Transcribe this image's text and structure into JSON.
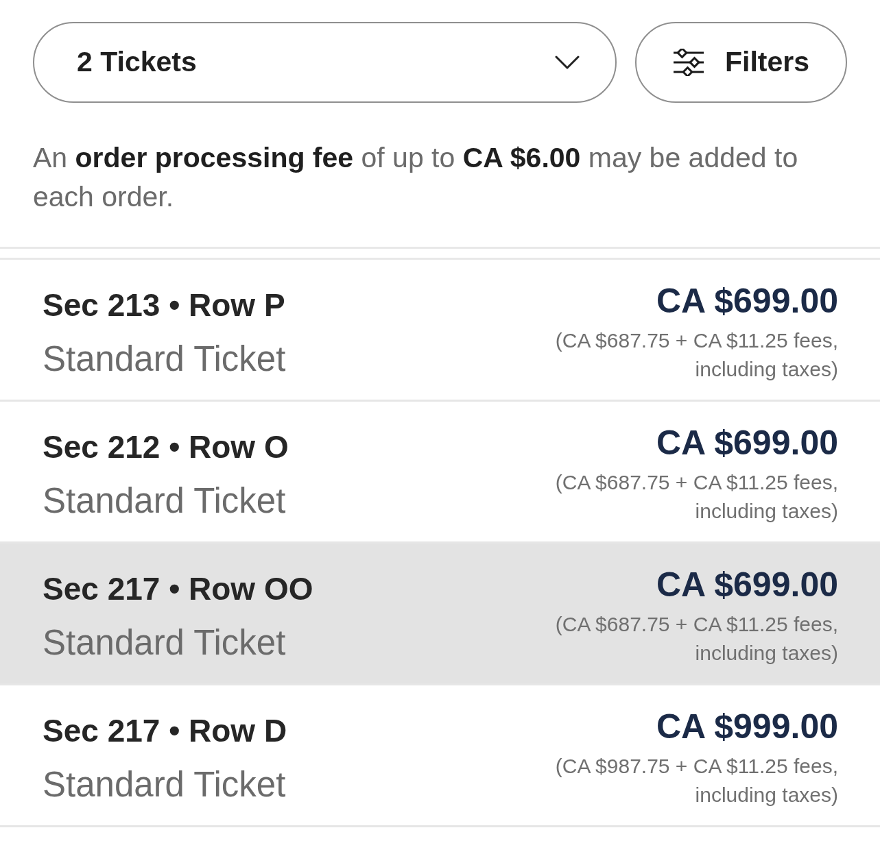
{
  "ticket_quantity": {
    "value": "2 Tickets"
  },
  "filters_button": {
    "label": "Filters"
  },
  "fee_notice": "An **order processing fee** of up to **CA $6.00** may be added to each order.",
  "listings": [
    {
      "section": "Sec 213 • Row P",
      "ticket_type": "Standard Ticket",
      "price": "CA $699.00",
      "price_breakdown": "(CA $687.75 + CA $11.25 fees, including taxes)",
      "selected": false
    },
    {
      "section": "Sec 212 • Row O",
      "ticket_type": "Standard Ticket",
      "price": "CA $699.00",
      "price_breakdown": "(CA $687.75 + CA $11.25 fees, including taxes)",
      "selected": false
    },
    {
      "section": "Sec 217 • Row OO",
      "ticket_type": "Standard Ticket",
      "price": "CA $699.00",
      "price_breakdown": "(CA $687.75 + CA $11.25 fees, including taxes)",
      "selected": true
    },
    {
      "section": "Sec 217 • Row D",
      "ticket_type": "Standard Ticket",
      "price": "CA $999.00",
      "price_breakdown": "(CA $987.75 + CA $11.25 fees, including taxes)",
      "selected": false
    }
  ]
}
